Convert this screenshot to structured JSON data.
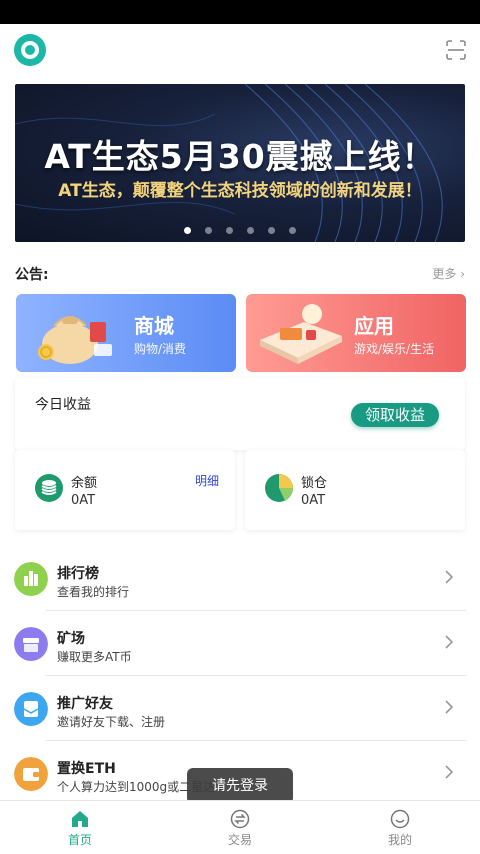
{
  "header": {
    "logo": "app-logo",
    "scan_icon": "scan-icon"
  },
  "banner": {
    "title": "AT生态5月30震撼上线！",
    "subtitle": "AT生态，颠覆整个生态科技领域的创新和发展！",
    "dots": 6,
    "active_dot": 0
  },
  "notice": {
    "label": "公告:",
    "more": "更多 ›"
  },
  "tiles": {
    "mall": {
      "title": "商城",
      "subtitle": "购物/消费"
    },
    "app": {
      "title": "应用",
      "subtitle": "游戏/娱乐/生活"
    }
  },
  "earnings": {
    "title": "今日收益",
    "claim_button": "领取收益"
  },
  "balance": {
    "label": "余额",
    "value": "0AT",
    "detail": "明细"
  },
  "lock": {
    "label": "锁仓",
    "value": "0AT"
  },
  "menu": [
    {
      "title": "排行榜",
      "subtitle": "查看我的排行",
      "icon": "trophy-icon",
      "color": "#8ed14f"
    },
    {
      "title": "矿场",
      "subtitle": "赚取更多AT币",
      "icon": "mine-icon",
      "color": "#8c7cf0"
    },
    {
      "title": "推广好友",
      "subtitle": "邀请好友下载、注册",
      "icon": "invite-icon",
      "color": "#3ea6ee"
    },
    {
      "title": "置换ETH",
      "subtitle": "个人算力达到1000g或二星达",
      "icon": "wallet-icon",
      "color": "#f0a23c"
    }
  ],
  "toast": "请先登录",
  "tabbar": [
    {
      "label": "首页",
      "icon": "home-icon",
      "active": true
    },
    {
      "label": "交易",
      "icon": "exchange-icon",
      "active": false
    },
    {
      "label": "我的",
      "icon": "profile-icon",
      "active": false
    }
  ],
  "colors": {
    "accent": "#23a98b",
    "claim_button": "#199a82",
    "mall_tile": "#5b8cf5",
    "app_tile": "#f06464"
  }
}
